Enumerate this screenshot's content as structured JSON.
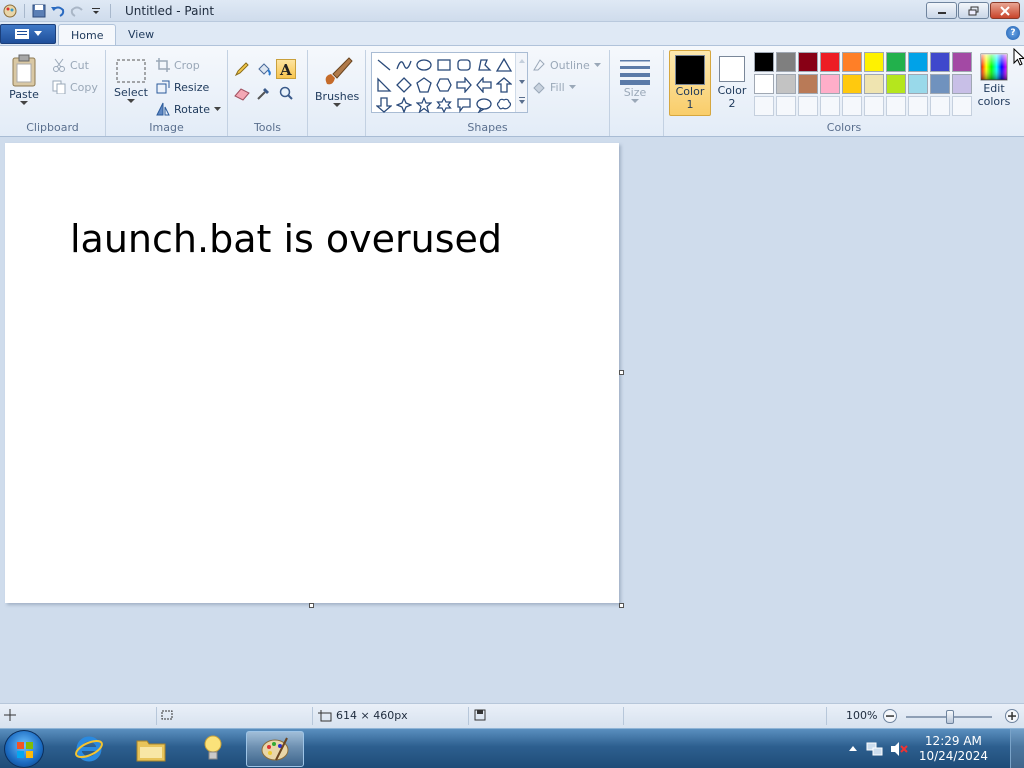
{
  "window": {
    "title": "Untitled - Paint"
  },
  "tabs": [
    {
      "label": "Home"
    },
    {
      "label": "View"
    }
  ],
  "clipboard": {
    "paste": "Paste",
    "cut": "Cut",
    "copy": "Copy",
    "label": "Clipboard"
  },
  "image": {
    "select": "Select",
    "crop": "Crop",
    "resize": "Resize",
    "rotate": "Rotate",
    "label": "Image"
  },
  "tools": {
    "label": "Tools",
    "selected": "text-tool"
  },
  "brushes": {
    "label": "Brushes"
  },
  "shapes": {
    "outline": "Outline",
    "fill": "Fill",
    "label": "Shapes"
  },
  "size": {
    "label": "Size"
  },
  "colors": {
    "color1_label": "Color",
    "color1_num": "1",
    "color2_label": "Color",
    "color2_num": "2",
    "edit_label": "Edit",
    "edit_label2": "colors",
    "label": "Colors",
    "color1": "#000000",
    "color2": "#ffffff",
    "palette_row1": [
      "#000000",
      "#7f7f7f",
      "#880015",
      "#ed1c24",
      "#ff7f27",
      "#fff200",
      "#22b14c",
      "#00a2e8",
      "#3f48cc",
      "#a349a4"
    ],
    "palette_row2": [
      "#ffffff",
      "#c3c3c3",
      "#b97a57",
      "#ffaec9",
      "#ffc90e",
      "#efe4b0",
      "#b5e61d",
      "#99d9ea",
      "#7092be",
      "#c8bfe7"
    ]
  },
  "canvas": {
    "text": "launch.bat is overused"
  },
  "status": {
    "dimensions": "614 × 460px",
    "zoom": "100%",
    "zoom_level": 1.0
  },
  "taskbar": {
    "time": "12:29 AM",
    "date": "10/24/2024"
  }
}
